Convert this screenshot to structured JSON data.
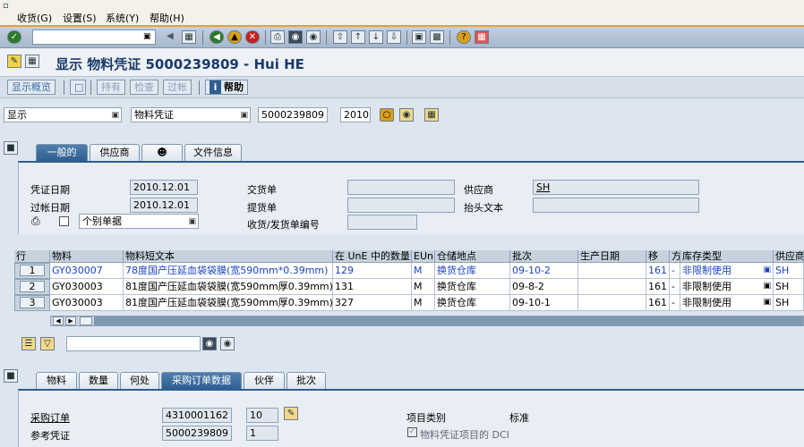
{
  "menu": {
    "items": [
      "收货(G)",
      "设置(S)",
      "系统(Y)",
      "帮助(H)"
    ]
  },
  "toolbar": {
    "command_field": "",
    "icons": [
      "enter-icon",
      "save-icon",
      "back-icon",
      "exit-icon",
      "cancel-icon",
      "print-icon",
      "find-icon",
      "find-next-icon",
      "first-page-icon",
      "prev-page-icon",
      "next-page-icon",
      "last-page-icon",
      "new-session-icon",
      "shortcut-icon",
      "help-icon",
      "layout-icon"
    ]
  },
  "title": "显示 物料凭证 5000239809 - Hui HE",
  "app_toolbar": {
    "overview": "显示概览",
    "hold": "持有",
    "check": "检查",
    "post": "过帐",
    "help": "帮助"
  },
  "selection": {
    "action": "显示",
    "doc_type": "物料凭证",
    "doc_number": "5000239809",
    "year": "2010"
  },
  "header_tabs": [
    "一般的",
    "供应商",
    "",
    "文件信息"
  ],
  "header_fields": {
    "doc_date_label": "凭证日期",
    "doc_date": "2010.12.01",
    "post_date_label": "过帐日期",
    "post_date": "2010.12.01",
    "slip_type": "个别单据",
    "delivery_note_label": "交货单",
    "delivery_note": "",
    "bill_of_lading_label": "提货单",
    "bill_of_lading": "",
    "gr_slip_label": "收货/发货单编号",
    "gr_slip": "",
    "vendor_label": "供应商",
    "vendor": "SH",
    "header_text_label": "抬头文本",
    "header_text": ""
  },
  "grid": {
    "headers": [
      "行",
      "物料",
      "物料短文本",
      "在 UnE 中的数量",
      "EUn",
      "仓储地点",
      "批次",
      "生产日期",
      "移",
      "方",
      "库存类型",
      "供应商"
    ],
    "rows": [
      {
        "line": "1",
        "material": "GY030007",
        "text": "78度国产压延血袋袋膜(宽590mm*0.39mm)",
        "qty": "129",
        "unit": "M",
        "sloc": "换货仓库",
        "batch": "09-10-2",
        "date": "",
        "mvt": "161",
        "dir": "-",
        "stock": "非限制使用",
        "vendor": "SH"
      },
      {
        "line": "2",
        "material": "GY030003",
        "text": "81度国产压延血袋袋膜(宽590mm厚0.39mm)",
        "qty": "131",
        "unit": "M",
        "sloc": "换货仓库",
        "batch": "09-8-2",
        "date": "",
        "mvt": "161",
        "dir": "-",
        "stock": "非限制使用",
        "vendor": "SH"
      },
      {
        "line": "3",
        "material": "GY030003",
        "text": "81度国产压延血袋袋膜(宽590mm厚0.39mm)",
        "qty": "327",
        "unit": "M",
        "sloc": "换货仓库",
        "batch": "09-10-1",
        "date": "",
        "mvt": "161",
        "dir": "-",
        "stock": "非限制使用",
        "vendor": "SH"
      }
    ]
  },
  "item_tabs": [
    "物料",
    "数量",
    "何处",
    "采购订单数据",
    "伙伴",
    "批次"
  ],
  "item_fields": {
    "po_label": "采购订单",
    "po": "4310001162",
    "po_item": "10",
    "ref_doc_label": "参考凭证",
    "ref_doc": "5000239809",
    "ref_item": "1",
    "item_cat_label": "项目类别",
    "item_cat": "标准",
    "dci_label": "物料凭证项目的 DCI"
  },
  "colors": {
    "accent": "#2f5e90",
    "orange": "#e8a030",
    "link": "#1a42c0"
  }
}
